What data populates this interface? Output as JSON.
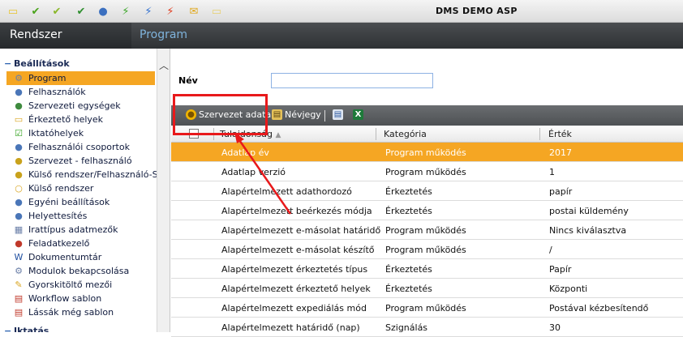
{
  "window": {
    "title": "DMS DEMO ASP"
  },
  "header": {
    "left_label": "Rendszer",
    "page_title": "Program"
  },
  "toolbar_icons": [
    {
      "name": "note-icon",
      "glyph": "▭",
      "color": "#e8c530"
    },
    {
      "name": "check-green-icon",
      "glyph": "✔",
      "color": "#4aa31b"
    },
    {
      "name": "double-check-icon",
      "glyph": "✔",
      "color": "#8ab72a"
    },
    {
      "name": "check-list-icon",
      "glyph": "✔",
      "color": "#2f8f2f"
    },
    {
      "name": "users-icon",
      "glyph": "●",
      "color": "#3b6fbf"
    },
    {
      "name": "lightning-green-icon",
      "glyph": "⚡",
      "color": "#3aa627"
    },
    {
      "name": "lightning-blue-icon",
      "glyph": "⚡",
      "color": "#2f6ecf"
    },
    {
      "name": "lightning-red-icon",
      "glyph": "⚡",
      "color": "#e03a1c"
    },
    {
      "name": "mail-icon",
      "glyph": "✉",
      "color": "#e0a91f"
    },
    {
      "name": "notepad-icon",
      "glyph": "▭",
      "color": "#e8d070"
    }
  ],
  "sidebar": {
    "section_title": "Beállítások",
    "next_section_title": "Iktatás",
    "items": [
      {
        "label": "Program",
        "icon": "gears-icon",
        "glyph": "⚙",
        "color": "#6b7fa8",
        "selected": true
      },
      {
        "label": "Felhasználók",
        "icon": "user-icon",
        "glyph": "●",
        "color": "#4a76b8"
      },
      {
        "label": "Szervezeti egységek",
        "icon": "org-units-icon",
        "glyph": "●",
        "color": "#3f8b3f"
      },
      {
        "label": "Érkeztető helyek",
        "icon": "inbox-icon",
        "glyph": "▭",
        "color": "#d9a520"
      },
      {
        "label": "Iktatóhelyek",
        "icon": "checkbox-icon",
        "glyph": "☑",
        "color": "#3aa627"
      },
      {
        "label": "Felhasználói csoportok",
        "icon": "group-icon",
        "glyph": "●",
        "color": "#4a76b8"
      },
      {
        "label": "Szervezet - felhasználó",
        "icon": "org-user-icon",
        "glyph": "●",
        "color": "#c9a21c"
      },
      {
        "label": "Külső rendszer/Felhasználó-Szerv",
        "icon": "external-user-icon",
        "glyph": "●",
        "color": "#c9a21c"
      },
      {
        "label": "Külső rendszer",
        "icon": "external-system-icon",
        "glyph": "○",
        "color": "#d9a520"
      },
      {
        "label": "Egyéni beállítások",
        "icon": "personal-settings-icon",
        "glyph": "●",
        "color": "#4a76b8"
      },
      {
        "label": "Helyettesítés",
        "icon": "substitute-icon",
        "glyph": "●",
        "color": "#4a76b8"
      },
      {
        "label": "Irattípus adatmezők",
        "icon": "grid-icon",
        "glyph": "▦",
        "color": "#6b7fa8"
      },
      {
        "label": "Feladatkezelő",
        "icon": "task-icon",
        "glyph": "●",
        "color": "#c0392b"
      },
      {
        "label": "Dokumentumtár",
        "icon": "word-icon",
        "glyph": "W",
        "color": "#1f4fa0"
      },
      {
        "label": "Modulok bekapcsolása",
        "icon": "modules-icon",
        "glyph": "⚙",
        "color": "#6b7fa8"
      },
      {
        "label": "Gyorskitöltő mezői",
        "icon": "quickfill-icon",
        "glyph": "✎",
        "color": "#d9a520"
      },
      {
        "label": "Workflow sablon",
        "icon": "workflow-icon",
        "glyph": "▤",
        "color": "#c0392b"
      },
      {
        "label": "Lássák még sablon",
        "icon": "template-icon",
        "glyph": "▤",
        "color": "#c0392b"
      }
    ]
  },
  "filter": {
    "label": "Név",
    "value": ""
  },
  "grid_toolbar": {
    "org_data_label": "Szervezet adatai",
    "business_card_label": "Névjegy"
  },
  "grid": {
    "headers": [
      "Tulajdonság",
      "Kategória",
      "Érték"
    ],
    "rows": [
      {
        "property": "Adatlap év",
        "category": "Program működés",
        "value": "2017",
        "selected": true
      },
      {
        "property": "Adatlap verzió",
        "category": "Program működés",
        "value": "1"
      },
      {
        "property": "Alapértelmezett adathordozó",
        "category": "Érkeztetés",
        "value": "papír"
      },
      {
        "property": "Alapértelmezett beérkezés módja",
        "category": "Érkeztetés",
        "value": "postai küldemény"
      },
      {
        "property": "Alapértelmezett e-másolat határidő",
        "category": "Program működés",
        "value": "Nincs kiválasztva"
      },
      {
        "property": "Alapértelmezett e-másolat készítő",
        "category": "Program működés",
        "value": "/"
      },
      {
        "property": "Alapértelmezett érkeztetés típus",
        "category": "Érkeztetés",
        "value": "Papír"
      },
      {
        "property": "Alapértelmezett érkeztető helyek",
        "category": "Érkeztetés",
        "value": "Központi"
      },
      {
        "property": "Alapértelmezett expediálás mód",
        "category": "Program működés",
        "value": "Postával kézbesítendő"
      },
      {
        "property": "Alapértelmezett határidő (nap)",
        "category": "Szignálás",
        "value": "30"
      }
    ]
  },
  "colors": {
    "selection": "#f5a623",
    "annotation": "#e8191b"
  }
}
